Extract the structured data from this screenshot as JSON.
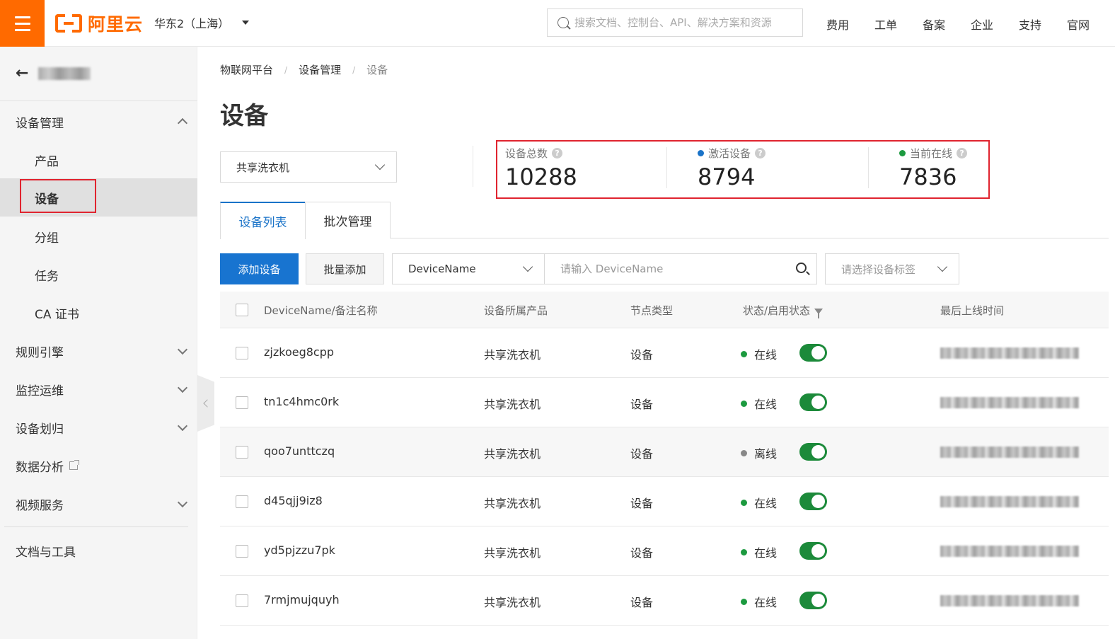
{
  "header": {
    "logo_text": "阿里云",
    "region": "华东2（上海）",
    "search_placeholder": "搜索文档、控制台、API、解决方案和资源",
    "nav": [
      "费用",
      "工单",
      "备案",
      "企业",
      "支持",
      "官网"
    ]
  },
  "sidebar": {
    "back_label": "",
    "groups": [
      {
        "label": "设备管理",
        "expanded": true
      },
      {
        "label": "规则引擎"
      },
      {
        "label": "监控运维"
      },
      {
        "label": "设备划归"
      },
      {
        "label": "数据分析"
      },
      {
        "label": "视频服务"
      },
      {
        "label": "文档与工具"
      }
    ],
    "sub_items": [
      "产品",
      "设备",
      "分组",
      "任务",
      "CA 证书"
    ],
    "active_item": "设备"
  },
  "breadcrumb": [
    "物联网平台",
    "设备管理",
    "设备"
  ],
  "page_title": "设备",
  "product_select": "共享洗衣机",
  "stats": [
    {
      "label": "设备总数",
      "value": "10288",
      "dot_color": null
    },
    {
      "label": "激活设备",
      "value": "8794",
      "dot_color": "#1a73c8"
    },
    {
      "label": "当前在线",
      "value": "7836",
      "dot_color": "#1c9a3f"
    }
  ],
  "tabs": [
    "设备列表",
    "批次管理"
  ],
  "toolbar": {
    "add_button": "添加设备",
    "batch_add_button": "批量添加",
    "field_select": "DeviceName",
    "search_placeholder": "请输入 DeviceName",
    "tag_placeholder": "请选择设备标签"
  },
  "table": {
    "columns": [
      "DeviceName/备注名称",
      "设备所属产品",
      "节点类型",
      "状态/启用状态",
      "最后上线时间"
    ],
    "rows": [
      {
        "name": "zjzkoeg8cpp",
        "product": "共享洗衣机",
        "node_type": "设备",
        "status": "在线",
        "status_color": "#1c9a3f",
        "enabled": true
      },
      {
        "name": "tn1c4hmc0rk",
        "product": "共享洗衣机",
        "node_type": "设备",
        "status": "在线",
        "status_color": "#1c9a3f",
        "enabled": true
      },
      {
        "name": "qoo7unttczq",
        "product": "共享洗衣机",
        "node_type": "设备",
        "status": "离线",
        "status_color": "#888888",
        "enabled": true
      },
      {
        "name": "d45qjj9iz8",
        "product": "共享洗衣机",
        "node_type": "设备",
        "status": "在线",
        "status_color": "#1c9a3f",
        "enabled": true
      },
      {
        "name": "yd5pjzzu7pk",
        "product": "共享洗衣机",
        "node_type": "设备",
        "status": "在线",
        "status_color": "#1c9a3f",
        "enabled": true
      },
      {
        "name": "7rmjmujquyh",
        "product": "共享洗衣机",
        "node_type": "设备",
        "status": "在线",
        "status_color": "#1c9a3f",
        "enabled": true
      }
    ]
  },
  "colors": {
    "brand": "#ff6a00",
    "primary": "#1874d0",
    "highlight": "#e0242f",
    "online": "#1c9a3f"
  }
}
